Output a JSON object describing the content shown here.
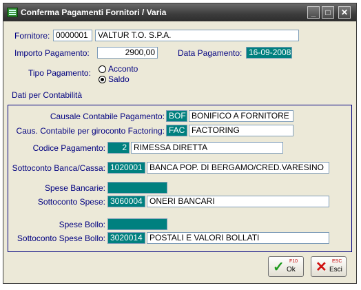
{
  "window": {
    "title": "Conferma Pagamenti Fornitori / Varia",
    "minimize_glyph": "_",
    "maximize_glyph": "□",
    "close_glyph": "✕"
  },
  "fornitore": {
    "label": "Fornitore:",
    "code": "0000001",
    "name": "VALTUR T.O. S.P.A."
  },
  "importo": {
    "label": "Importo Pagamento:",
    "value": "2900,00"
  },
  "data_pagamento": {
    "label": "Data Pagamento:",
    "value": "16-09-2008"
  },
  "tipo_pagamento": {
    "label": "Tipo Pagamento:",
    "options": [
      {
        "label": "Acconto",
        "selected": false
      },
      {
        "label": "Saldo",
        "selected": true
      }
    ]
  },
  "contabilita": {
    "section_title": "Dati per Contabilità",
    "causale_pagamento": {
      "label": "Causale Contabile Pagamento:",
      "code": "BOF",
      "desc": "BONIFICO A FORNITORE"
    },
    "causale_factoring": {
      "label": "Caus. Contabile per giroconto Factoring:",
      "code": "FAC",
      "desc": "FACTORING"
    },
    "codice_pagamento": {
      "label": "Codice Pagamento:",
      "code": "2",
      "desc": "RIMESSA DIRETTA"
    },
    "sottoconto_banca": {
      "label": "Sottoconto Banca/Cassa:",
      "code": "1020001",
      "desc": "BANCA POP. DI BERGAMO/CRED.VARESINO"
    },
    "spese_bancarie": {
      "label": "Spese Bancarie:",
      "value": ""
    },
    "sottoconto_spese": {
      "label": "Sottoconto Spese:",
      "code": "3060004",
      "desc": "ONERI BANCARI"
    },
    "spese_bollo": {
      "label": "Spese Bollo:",
      "value": ""
    },
    "sottoconto_bollo": {
      "label": "Sottoconto Spese Bollo:",
      "code": "3020014",
      "desc": "POSTALI E VALORI BOLLATI"
    }
  },
  "buttons": {
    "ok": {
      "key": "F10",
      "label": "Ok",
      "icon": "check-icon"
    },
    "esci": {
      "key": "ESC",
      "label": "Esci",
      "icon": "cross-icon"
    }
  },
  "colors": {
    "accent": "#00807f",
    "label": "#000080",
    "titlebar": "#3c3c3c"
  }
}
